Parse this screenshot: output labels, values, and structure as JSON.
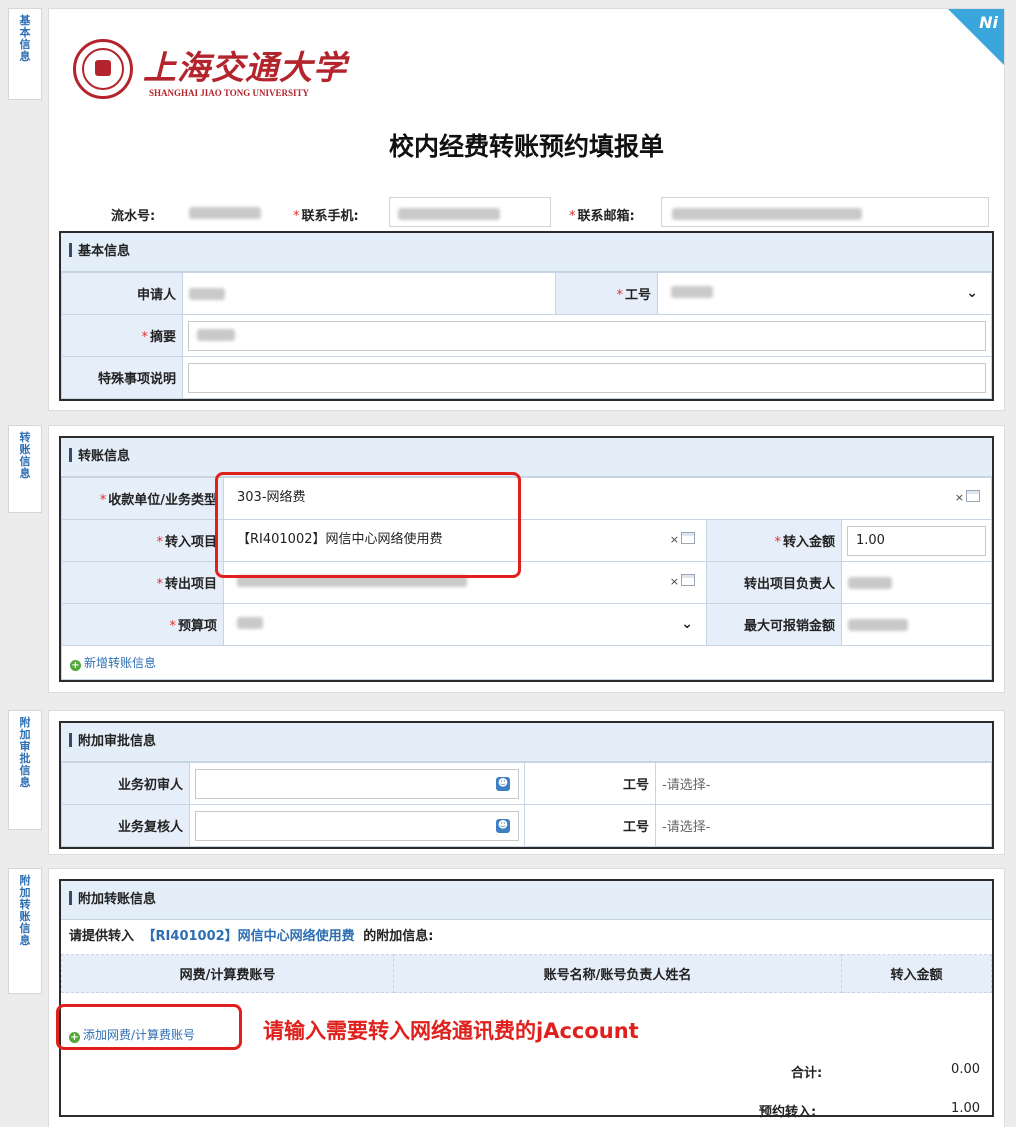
{
  "side_tabs": {
    "basic": "基本信息",
    "transfer": "转账信息",
    "approval": "附加审批信息",
    "extra": "附加转账信息"
  },
  "logo": {
    "cn": "上海交通大学",
    "en": "SHANGHAI JIAO TONG UNIVERSITY"
  },
  "corner_badge": "Ni",
  "form_title": "校内经费转账预约填报单",
  "top_fields": {
    "serial_label": "流水号:",
    "phone_label": "联系手机:",
    "email_label": "联系邮箱:"
  },
  "basic": {
    "header": "基本信息",
    "applicant_label": "申请人",
    "staff_no_label": "工号",
    "summary_label": "摘要",
    "special_label": "特殊事项说明"
  },
  "transfer": {
    "header": "转账信息",
    "payee_label": "收款单位/业务类型",
    "payee_value": "303-网络费",
    "in_project_label": "转入项目",
    "in_project_value": "【RI401002】网信中心网络使用费",
    "in_amount_label": "转入金额",
    "in_amount_value": "1.00",
    "out_project_label": "转出项目",
    "out_manager_label": "转出项目负责人",
    "budget_label": "预算项",
    "max_amount_label": "最大可报销金额",
    "add_link": "新增转账信息",
    "clear_glyph": "×"
  },
  "approval": {
    "header": "附加审批信息",
    "first_reviewer_label": "业务初审人",
    "second_reviewer_label": "业务复核人",
    "staff_no_label": "工号",
    "select_placeholder": "-请选择-"
  },
  "extra": {
    "header": "附加转账信息",
    "prompt_prefix": "请提供转入",
    "prompt_project": "【RI401002】网信中心网络使用费",
    "prompt_suffix": "的附加信息:",
    "columns": [
      "网费/计算费账号",
      "账号名称/账号负责人姓名",
      "转入金额"
    ],
    "add_link": "添加网费/计算费账号",
    "annotation": "请输入需要转入网络通讯费的jAccount",
    "total_label": "合计:",
    "total_value": "0.00",
    "reserved_label": "预约转入:",
    "reserved_value": "1.00"
  },
  "colors": {
    "accent": "#2e6fb4",
    "header_bg": "#e3eef9",
    "label_bg": "#e6eff9",
    "annotation": "#e0201c",
    "badge": "#3aa6dc"
  }
}
